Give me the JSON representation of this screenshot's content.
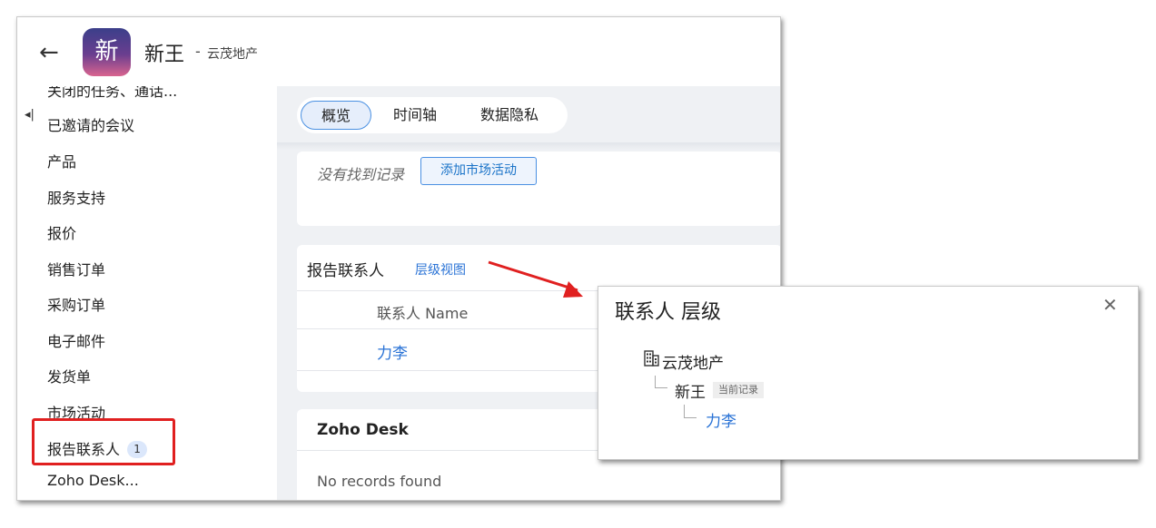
{
  "header": {
    "back_icon": "arrow-left-icon",
    "avatar_text": "新",
    "record_name": "新王",
    "separator": "-",
    "company": "云茂地产"
  },
  "sidebar": {
    "items": [
      {
        "label": "关闭的任务、通话..."
      },
      {
        "label": "已邀请的会议"
      },
      {
        "label": "产品"
      },
      {
        "label": "服务支持"
      },
      {
        "label": "报价"
      },
      {
        "label": "销售订单"
      },
      {
        "label": "采购订单"
      },
      {
        "label": "电子邮件"
      },
      {
        "label": "发货单"
      },
      {
        "label": "市场活动"
      },
      {
        "label": "报告联系人",
        "count": "1"
      },
      {
        "label": "Zoho Desk..."
      }
    ]
  },
  "tabs": [
    {
      "label": "概览",
      "active": true
    },
    {
      "label": "时间轴",
      "active": false
    },
    {
      "label": "数据隐私",
      "active": false
    }
  ],
  "campaign_card": {
    "empty_text": "没有找到记录",
    "add_button": "添加市场活动"
  },
  "reports_card": {
    "title": "报告联系人",
    "hierarchy_link": "层级视图",
    "column_header": "联系人 Name",
    "rows": [
      "力李"
    ]
  },
  "desk_card": {
    "title": "Zoho Desk",
    "empty_text": "No records found"
  },
  "popup": {
    "title": "联系人 层级",
    "close_icon": "close-icon",
    "company_icon": "building-icon",
    "company": "云茂地产",
    "current_record": "新王",
    "current_badge": "当前记录",
    "child": "力李"
  },
  "colors": {
    "link": "#2a73d6",
    "highlight": "#e02020",
    "arrow": "#e02020",
    "avatar_gradient": [
      "#3b3f8a",
      "#6a3e8f",
      "#d9648f"
    ]
  }
}
